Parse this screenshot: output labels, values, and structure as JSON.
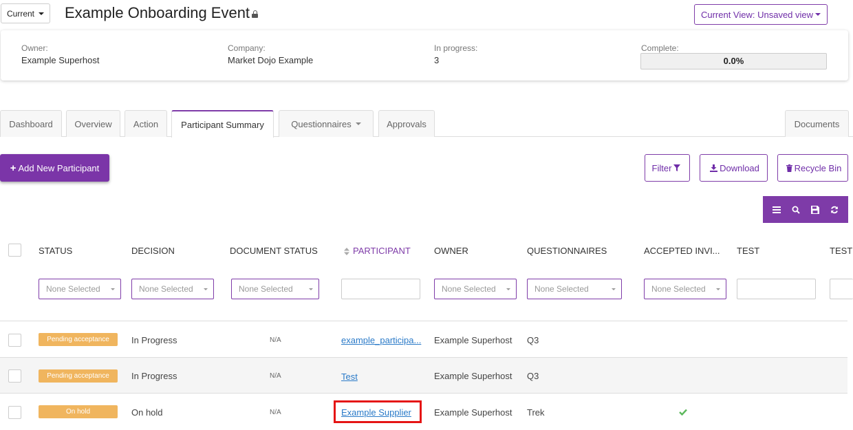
{
  "header": {
    "version_label": "Current",
    "title": "Example Onboarding Event",
    "view_label": "Current View: Unsaved view"
  },
  "info": {
    "owner_label": "Owner:",
    "owner_value": "Example Superhost",
    "company_label": "Company:",
    "company_value": "Market Dojo Example",
    "in_progress_label": "In progress:",
    "in_progress_value": "3",
    "complete_label": "Complete:",
    "complete_value": "0.0%",
    "complete_fraction": 0.0
  },
  "tabs": [
    {
      "label": "Dashboard"
    },
    {
      "label": "Overview"
    },
    {
      "label": "Action"
    },
    {
      "label": "Participant Summary"
    },
    {
      "label": "Questionnaires"
    },
    {
      "label": "Approvals"
    },
    {
      "label": "Documents"
    }
  ],
  "actions": {
    "add_label": "Add New Participant",
    "filter_label": "Filter",
    "download_label": "Download",
    "recycle_label": "Recycle Bin"
  },
  "table": {
    "columns": [
      "STATUS",
      "DECISION",
      "DOCUMENT STATUS",
      "PARTICIPANT",
      "OWNER",
      "QUESTIONNAIRES",
      "ACCEPTED INVI...",
      "TEST",
      "TEST"
    ],
    "filter_placeholder": "None Selected",
    "rows": [
      {
        "status": "Pending acceptance",
        "decision": "In Progress",
        "doc_status": "N/A",
        "participant": "example_participa...",
        "owner": "Example Superhost",
        "questionnaires": "Q3"
      },
      {
        "status": "Pending acceptance",
        "decision": "In Progress",
        "doc_status": "N/A",
        "participant": "Test",
        "owner": "Example Superhost",
        "questionnaires": "Q3"
      },
      {
        "status": "On hold",
        "decision": "On hold",
        "doc_status": "N/A",
        "participant": "Example Supplier",
        "owner": "Example Superhost",
        "questionnaires": "Trek",
        "accepted": true
      }
    ]
  },
  "colors": {
    "accent": "#7e3ba8",
    "badge": "#f0b55e",
    "link": "#2a7ac8",
    "highlight": "#e51414",
    "check": "#5cb85c"
  }
}
